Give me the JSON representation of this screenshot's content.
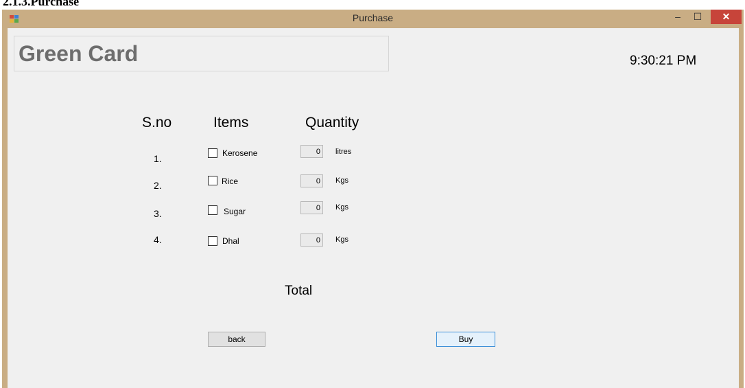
{
  "document": {
    "heading": "2.1.3.Purchase"
  },
  "window": {
    "title": "Purchase",
    "controls": {
      "minimize": "–",
      "maximize": "☐",
      "close": "✕"
    },
    "icon": "app-icon"
  },
  "header": {
    "card_title": "Green Card",
    "clock": "9:30:21 PM"
  },
  "table": {
    "col_sno": "S.no",
    "col_items": "Items",
    "col_quantity": "Quantity"
  },
  "rows": [
    {
      "sno": "1.",
      "item": "Kerosene",
      "quantity": "0",
      "unit": "litres",
      "checked": false
    },
    {
      "sno": "2.",
      "item": "Rice",
      "quantity": "0",
      "unit": "Kgs",
      "checked": false
    },
    {
      "sno": "3.",
      "item": "Sugar",
      "quantity": "0",
      "unit": "Kgs",
      "checked": false
    },
    {
      "sno": "4.",
      "item": "Dhal",
      "quantity": "0",
      "unit": "Kgs",
      "checked": false
    }
  ],
  "total_label": "Total",
  "buttons": {
    "back": "back",
    "buy": "Buy"
  },
  "colors": {
    "title_bar": "#c9ad84",
    "client": "#f0f0f0",
    "close_button": "#c7443a"
  }
}
